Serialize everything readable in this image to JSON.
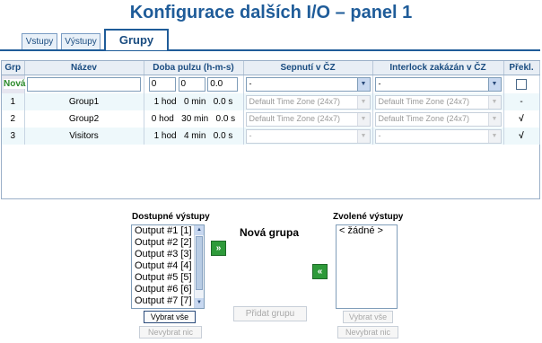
{
  "page": {
    "title": "Konfigurace dalších I/O – panel 1"
  },
  "tabs": [
    {
      "label": "Vstupy"
    },
    {
      "label": "Výstupy"
    },
    {
      "label": "Grupy"
    }
  ],
  "table": {
    "headers": {
      "grp": "Grp",
      "name": "Název",
      "pulse": "Doba pulzu (h-m-s)",
      "on": "Sepnutí v ČZ",
      "interlock": "Interlock zakázán v ČZ",
      "override": "Překl."
    },
    "new_row": {
      "label": "Nová",
      "name_value": "",
      "h": "0",
      "m": "0",
      "s": "0.0",
      "on_value": "-",
      "interlock_value": "-"
    },
    "rows": [
      {
        "grp": "1",
        "name": "Group1",
        "pulse": "1 hod   0 min   0.0 s",
        "on": "Default Time Zone (24x7)",
        "interlock": "Default Time Zone (24x7)",
        "override": "-"
      },
      {
        "grp": "2",
        "name": "Group2",
        "pulse": "0 hod   30 min   0.0 s",
        "on": "Default Time Zone (24x7)",
        "interlock": "Default Time Zone (24x7)",
        "override": "√"
      },
      {
        "grp": "3",
        "name": "Visitors",
        "pulse": "1 hod   4 min   0.0 s",
        "on": "-",
        "interlock": "-",
        "override": "√"
      }
    ]
  },
  "available": {
    "label": "Dostupné výstupy",
    "items": [
      "Output #1 [1]",
      "Output #2 [2]",
      "Output #3 [3]",
      "Output #4 [4]",
      "Output #5 [5]",
      "Output #6 [6]",
      "Output #7 [7]"
    ],
    "select_all": "Vybrat vše",
    "deselect": "Nevybrat nic"
  },
  "new_group": {
    "label": "Nová grupa",
    "add_button": "Přidat grupu"
  },
  "selected": {
    "label": "Zvolené výstupy",
    "items": [
      "< žádné >"
    ],
    "select_all": "Vybrat vše",
    "deselect": "Nevybrat nic"
  },
  "arrows": {
    "add": "»",
    "remove": "«"
  }
}
